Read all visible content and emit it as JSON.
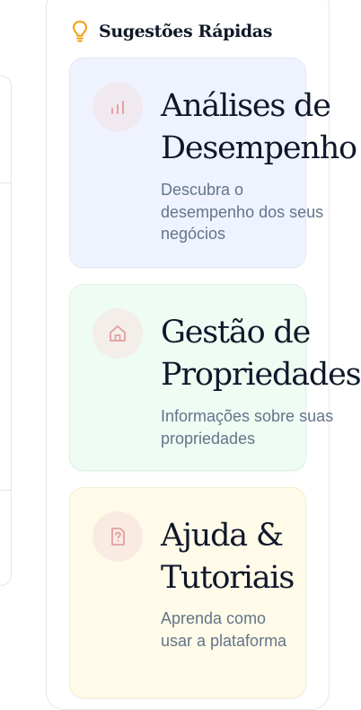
{
  "panel": {
    "title": "Sugestões Rápidas",
    "icon": "lightbulb-icon",
    "accent_color": "#f59e0b"
  },
  "cards": [
    {
      "title_line1": "Análises de",
      "title_line2": "Desempenho",
      "description": "Descubra o desempenho dos seus negócios",
      "icon": "bar-chart-icon",
      "background": "#eff3ff"
    },
    {
      "title_line1": "Gestão de",
      "title_line2": "Propriedades",
      "description": "Informações sobre suas propriedades",
      "icon": "home-icon",
      "background": "#eefcf3"
    },
    {
      "title_line1": "Ajuda &",
      "title_line2": "Tutoriais",
      "description": "Aprenda como usar a plataforma",
      "icon": "help-file-icon",
      "background": "#fffbe8"
    }
  ],
  "icon_color": "#e2a0a0"
}
